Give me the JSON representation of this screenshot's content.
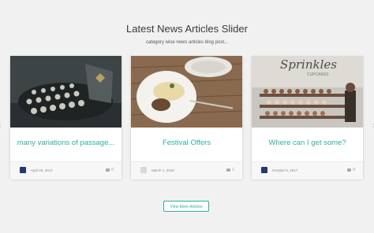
{
  "section": {
    "title": "Latest News Articles Slider",
    "subtitle": "category wise news articles blog post..."
  },
  "cards": [
    {
      "headline": "many variations of passage...",
      "date": "April 29, 2017",
      "comments": "0",
      "image_icon": "typewriter-image",
      "avatar_color": "#1f3b6b"
    },
    {
      "headline": "Festival Offers",
      "date": "March 1, 2019",
      "comments": "1",
      "image_icon": "food-plate-image",
      "avatar_color": "#d8d8d8"
    },
    {
      "headline": "Where can I get some?",
      "date": "October 5, 2017",
      "comments": "0",
      "image_icon": "cupcake-shop-image",
      "avatar_color": "#1f3b6b",
      "image_text": "Sprinkles",
      "image_subtext": "CUPCAKES"
    }
  ],
  "controls": {
    "prev_icon": "‹",
    "next_icon": "›",
    "view_more_label": "View More Articles"
  },
  "colors": {
    "accent": "#2bb0a0"
  }
}
